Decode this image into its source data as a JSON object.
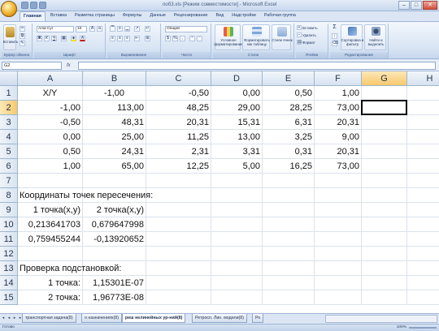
{
  "window": {
    "title": "лоб3.xls [Режим совместимости] - Microsoft Excel",
    "minimize": "–",
    "maximize": "□",
    "close": "✕"
  },
  "ribbon_tabs": [
    "Главная",
    "Вставка",
    "Разметка страницы",
    "Формулы",
    "Данные",
    "Рецензирование",
    "Вид",
    "Надстройки",
    "Рабочая группа"
  ],
  "ribbon": {
    "clipboard": {
      "paste_label": "Вставить",
      "group_label": "Буфер обмена"
    },
    "font": {
      "font_name": "Arial Cyr",
      "font_size": "10",
      "bold": "Ж",
      "italic": "К",
      "underline": "Ч",
      "group_label": "Шрифт"
    },
    "alignment": {
      "group_label": "Выравнивание"
    },
    "number": {
      "format": "Общий",
      "group_label": "Число"
    },
    "styles": {
      "cond_label": "Условное форматирование",
      "table_label": "Форматировать как таблицу",
      "cell_styles_label": "Стили ячеек",
      "group_label": "Стили"
    },
    "cells": {
      "insert_label": "Вставить",
      "delete_label": "Удалить",
      "format_label": "Формат",
      "group_label": "Ячейки"
    },
    "editing": {
      "sum": "Σ",
      "sort_label": "Сортировка и фильтр",
      "find_label": "Найти и выделить",
      "group_label": "Редактирование"
    }
  },
  "formula_bar": {
    "name_box": "G2",
    "fx": "fx",
    "value": ""
  },
  "columns": [
    "A",
    "B",
    "C",
    "D",
    "E",
    "F",
    "G",
    "H"
  ],
  "rows": [
    {
      "n": "1",
      "cells": [
        "X/Y",
        "-1,00",
        "-0,50",
        "0,00",
        "0,50",
        "1,00",
        "",
        ""
      ]
    },
    {
      "n": "2",
      "cells": [
        "-1,00",
        "113,00",
        "48,25",
        "29,00",
        "28,25",
        "73,00",
        "",
        ""
      ]
    },
    {
      "n": "3",
      "cells": [
        "-0,50",
        "48,31",
        "20,31",
        "15,31",
        "6,31",
        "20,31",
        "",
        ""
      ]
    },
    {
      "n": "4",
      "cells": [
        "0,00",
        "25,00",
        "11,25",
        "13,00",
        "3,25",
        "9,00",
        "",
        ""
      ]
    },
    {
      "n": "5",
      "cells": [
        "0,50",
        "24,31",
        "2,31",
        "3,31",
        "0,31",
        "20,31",
        "",
        ""
      ]
    },
    {
      "n": "6",
      "cells": [
        "1,00",
        "65,00",
        "12,25",
        "5,00",
        "16,25",
        "73,00",
        "",
        ""
      ]
    },
    {
      "n": "7",
      "cells": [
        "",
        "",
        "",
        "",
        "",
        "",
        "",
        ""
      ]
    },
    {
      "n": "8",
      "cells": [
        "Координаты точек пересечения:",
        "",
        "",
        "",
        "",
        "",
        "",
        ""
      ]
    },
    {
      "n": "9",
      "cells": [
        "1 точка(x,y)",
        "2 точка(x,y)",
        "",
        "",
        "",
        "",
        "",
        ""
      ]
    },
    {
      "n": "10",
      "cells": [
        "0,213641703",
        "0,679647998",
        "",
        "",
        "",
        "",
        "",
        ""
      ]
    },
    {
      "n": "11",
      "cells": [
        "0,759455244",
        "-0,13920652",
        "",
        "",
        "",
        "",
        "",
        ""
      ]
    },
    {
      "n": "12",
      "cells": [
        "",
        "",
        "",
        "",
        "",
        "",
        "",
        ""
      ]
    },
    {
      "n": "13",
      "cells": [
        "Проверка подстановкой:",
        "",
        "",
        "",
        "",
        "",
        "",
        ""
      ]
    },
    {
      "n": "14",
      "cells": [
        "1 точка:",
        "1,15301E-07",
        "",
        "",
        "",
        "",
        "",
        ""
      ]
    },
    {
      "n": "15",
      "cells": [
        "2 точка:",
        "1,96773E-08",
        "",
        "",
        "",
        "",
        "",
        ""
      ]
    }
  ],
  "active_cell": "G2",
  "sheet_tabs": [
    "транспортная задача(8)",
    "о назначениях(8)",
    "реш нелинейных ур-ний(8)",
    "Ретросп. Лин. модели(8)",
    "Ро"
  ],
  "active_sheet_index": 2,
  "status": {
    "ready": "Готово",
    "zoom": "100%"
  },
  "colors": {
    "accent": "#1d3a6e",
    "selected_header": "#f7c86c",
    "grid_line": "#dbe2ec"
  }
}
